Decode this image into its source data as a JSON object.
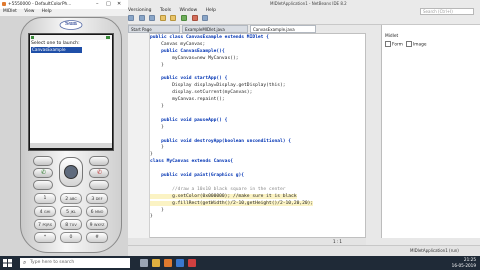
{
  "ide": {
    "title": "MIDletApplication1 - NetBeans IDE 8.2",
    "menu": [
      "Versioning",
      "Tools",
      "Window",
      "Help"
    ],
    "search_placeholder": "Search (Ctrl+I)",
    "tabs": [
      {
        "label": "Start Page",
        "active": false
      },
      {
        "label": "ExampleMIDlet.java",
        "active": false
      },
      {
        "label": "CanvasExample.java",
        "active": true
      }
    ],
    "line_numbers": [
      "",
      "",
      "",
      "",
      "",
      "",
      "",
      "",
      "",
      "",
      "",
      "",
      "",
      "",
      "",
      "",
      "",
      "",
      "",
      "",
      "",
      "",
      "",
      "",
      "",
      "",
      "",
      "",
      "",
      ""
    ],
    "code": [
      {
        "text": "public class CanvasExample extends MIDlet {",
        "cls": "kw"
      },
      {
        "text": "    Canvas myCanvas;",
        "cls": ""
      },
      {
        "text": "    public CanvasExample(){",
        "cls": "kw"
      },
      {
        "text": "        myCanvas=new MyCanvas();",
        "cls": ""
      },
      {
        "text": "    }",
        "cls": ""
      },
      {
        "text": "",
        "cls": ""
      },
      {
        "text": "    public void startApp() {",
        "cls": "kw"
      },
      {
        "text": "        Display display=Display.getDisplay(this);",
        "cls": ""
      },
      {
        "text": "        display.setCurrent(myCanvas);",
        "cls": ""
      },
      {
        "text": "        myCanvas.repaint();",
        "cls": ""
      },
      {
        "text": "    }",
        "cls": ""
      },
      {
        "text": "",
        "cls": ""
      },
      {
        "text": "    public void pauseApp() {",
        "cls": "kw"
      },
      {
        "text": "    }",
        "cls": ""
      },
      {
        "text": "",
        "cls": ""
      },
      {
        "text": "    public void destroyApp(boolean unconditional) {",
        "cls": "kw"
      },
      {
        "text": "    }",
        "cls": ""
      },
      {
        "text": "}",
        "cls": ""
      },
      {
        "text": "class MyCanvas extends Canvas{",
        "cls": "kw"
      },
      {
        "text": "",
        "cls": ""
      },
      {
        "text": "    public void paint(Graphics g){",
        "cls": "kw"
      },
      {
        "text": "",
        "cls": ""
      },
      {
        "text": "        //draw a 10x10 black square in the center",
        "cls": "cm"
      },
      {
        "text": "        g.setColor(0x000000); //make sure it is black",
        "cls": "hl"
      },
      {
        "text": "        g.fillRect(getWidth()/2-10,getHeight()/2-10,20,20);",
        "cls": "hl"
      },
      {
        "text": "    }",
        "cls": ""
      },
      {
        "text": "}",
        "cls": ""
      }
    ],
    "editor_status": "1 : 1",
    "output_status": "MIDletApplication1 (run)",
    "palette": {
      "title": "Palette",
      "items": [
        "Midlet"
      ],
      "checkbox_items": [
        "Form",
        "Image"
      ]
    }
  },
  "emulator": {
    "title": "+5550000 - DefaultColorPh...",
    "menu": [
      "MIDlet",
      "View",
      "Help"
    ],
    "brand": "Sun",
    "screen_prompt": "Select one to launch:",
    "list_item": "CanvasExample",
    "keys": [
      {
        "label": "1",
        "sub": ""
      },
      {
        "label": "2",
        "sub": "ABC"
      },
      {
        "label": "3",
        "sub": "DEF"
      },
      {
        "label": "4",
        "sub": "GHI"
      },
      {
        "label": "5",
        "sub": "JKL"
      },
      {
        "label": "6",
        "sub": "MNO"
      },
      {
        "label": "7",
        "sub": "PQRS"
      },
      {
        "label": "8",
        "sub": "TUV"
      },
      {
        "label": "9",
        "sub": "WXYZ"
      },
      {
        "label": "*",
        "sub": ""
      },
      {
        "label": "0",
        "sub": ""
      },
      {
        "label": "#",
        "sub": ""
      }
    ]
  },
  "taskbar": {
    "search_placeholder": "Type here to search",
    "time": "21:25",
    "date": "16-05-2019"
  },
  "colors": {
    "accent": "#1f4fa8",
    "taskbar": "#1f2a37"
  }
}
